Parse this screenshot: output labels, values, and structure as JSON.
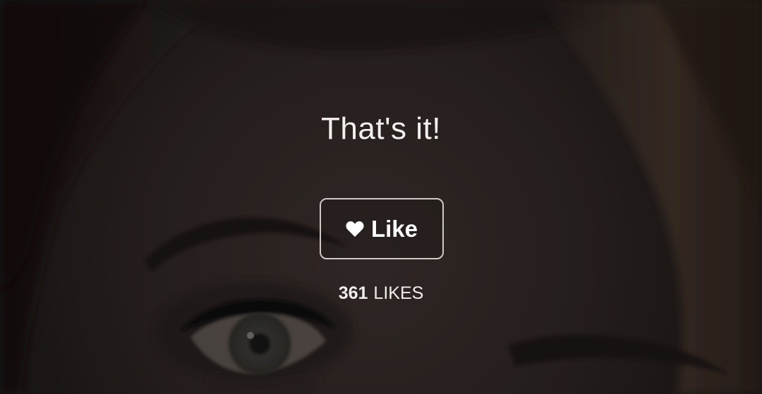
{
  "main": {
    "title": "That's it!",
    "like_button": {
      "icon": "heart-icon",
      "label": "Like"
    },
    "likes": {
      "count": "361",
      "unit": "LIKES"
    }
  },
  "colors": {
    "text": "#ffffff",
    "button_border": "#cfcac6",
    "background_dark": "#1c1817"
  }
}
